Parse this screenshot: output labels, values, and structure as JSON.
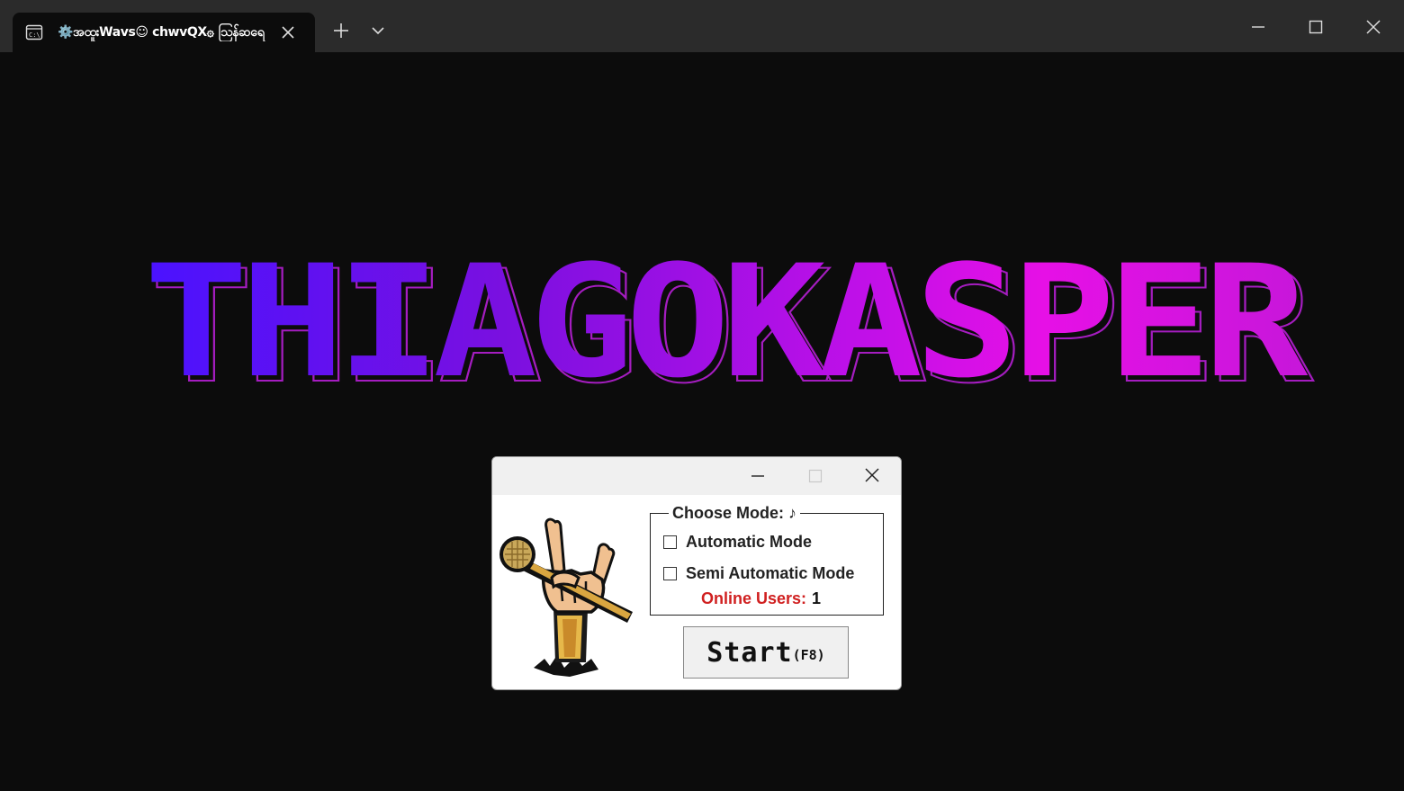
{
  "terminal": {
    "tab_title": "⚙️အထူးWavs☺ chwvQX۞ ဩန်ဆရေ",
    "tab_icon": "console-icon",
    "new_tab_icon": "plus-icon",
    "dropdown_icon": "chevron-down-icon",
    "window_controls": [
      "minimize-icon",
      "maximize-icon",
      "close-icon"
    ]
  },
  "banner": {
    "text": "THIAGOKASPER",
    "gradient_start": "#4a12ff",
    "gradient_end": "#e610e6"
  },
  "dialog": {
    "controls": [
      "minimize-icon",
      "maximize-icon",
      "close-icon"
    ],
    "mascot_icon": "microphone-rock-hand-icon",
    "group_title": "Choose Mode: ♪",
    "options": [
      {
        "label": "Automatic Mode",
        "checked": false
      },
      {
        "label": "Semi Automatic Mode",
        "checked": false
      }
    ],
    "online_label": "Online Users:",
    "online_count": "1",
    "online_label_color": "#d02020",
    "start_label": "Start",
    "start_hotkey": "(F8)"
  }
}
